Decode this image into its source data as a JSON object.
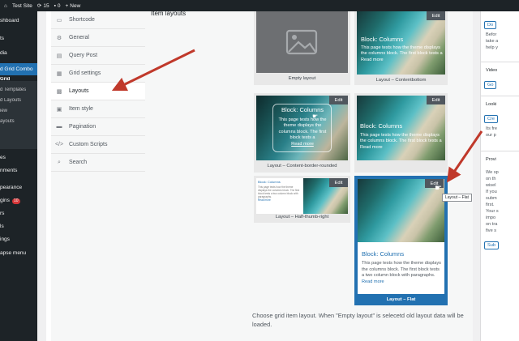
{
  "adminbar": {
    "site_name": "Test Site",
    "updates_count": "15",
    "comments_count": "0",
    "new_label": "New"
  },
  "adminmenu": {
    "dashboard": "shboard",
    "posts": "ts",
    "media": "dia",
    "plugin": "d Grid Combo",
    "sub_grid": "Grid",
    "sub_templates": "d Templates",
    "sub_layouts": "d Layouts",
    "sub_view": "iew",
    "sub_ayouts": "ayouts",
    "pages": "es",
    "comments": "nments",
    "appearance": "pearance",
    "plugins": "gins",
    "plugins_badge": "10",
    "users": "rs",
    "tools": "ls",
    "settings": "ings",
    "collapse": "apse menu"
  },
  "tabs": [
    {
      "label": "Shortcode",
      "icon": "shortcode-icon"
    },
    {
      "label": "General",
      "icon": "gear-icon"
    },
    {
      "label": "Query Post",
      "icon": "query-icon"
    },
    {
      "label": "Grid settings",
      "icon": "grid-settings-icon"
    },
    {
      "label": "Layouts",
      "icon": "layouts-icon"
    },
    {
      "label": "Item style",
      "icon": "item-style-icon"
    },
    {
      "label": "Pagination",
      "icon": "pagination-icon"
    },
    {
      "label": "Custom Scripts",
      "icon": "code-icon"
    },
    {
      "label": "Search",
      "icon": "search-icon"
    }
  ],
  "active_tab": "Layouts",
  "section_title": "Item layouts",
  "layouts": {
    "empty": {
      "caption": "Empty layout"
    },
    "contentbottom": {
      "caption": "Layout – Contentbottom",
      "edit": "Edit",
      "title": "Block: Columns",
      "text": "This page tests how the theme displays the columns block. The first block tests a",
      "more": "Read more"
    },
    "border_rounded": {
      "caption": "Layout – Content-border-rounded",
      "edit": "Edit",
      "title": "Block: Columns",
      "text": "This page tests how the theme displays the columns block. The first block tests a",
      "more": "Read more"
    },
    "half": {
      "caption": "Layout – Half-thumb-right",
      "edit": "Edit",
      "title": "Block: Columns",
      "text": "This page tests how the theme displays the columns block. The first block tests a two column block with paragraphs.",
      "more": "Read more"
    },
    "fourth": {
      "caption": "",
      "edit": "Edit",
      "title": "Block: Columns",
      "text": "This page tests how the theme displays the columns block. The first block tests a",
      "more": "Read more"
    },
    "flat": {
      "caption": "Layout – Flat",
      "edit": "Edit",
      "title": "Block: Columns",
      "text": "This page tests how the theme displays the columns block. The first block tests a two column block with paragraphs.",
      "more": "Read more",
      "tooltip": "Layout – Flat"
    }
  },
  "description": "Choose grid item layout. When \"Empty layout\" is selecetd old layout data will be loaded.",
  "rightbar": {
    "btn1": "Do",
    "line1": "Befor",
    "line2": "take a",
    "line3": "help y",
    "video": "Video",
    "btn2": "Go",
    "looking": "Looki",
    "btn3": "Cre",
    "line4": "Its fre",
    "line5": "our p",
    "provide": "Provi",
    "lines_b": [
      "We sp",
      "on th",
      "wisel",
      "If you",
      "subm",
      "first.",
      "Your s",
      "impo",
      "on tra",
      "five s"
    ],
    "btn4": "Sub"
  },
  "colors": {
    "admin_dark": "#1d2327",
    "accent_blue": "#2271b1",
    "selected_border": "#2271b1",
    "annotation_arrow": "#c0392b"
  }
}
